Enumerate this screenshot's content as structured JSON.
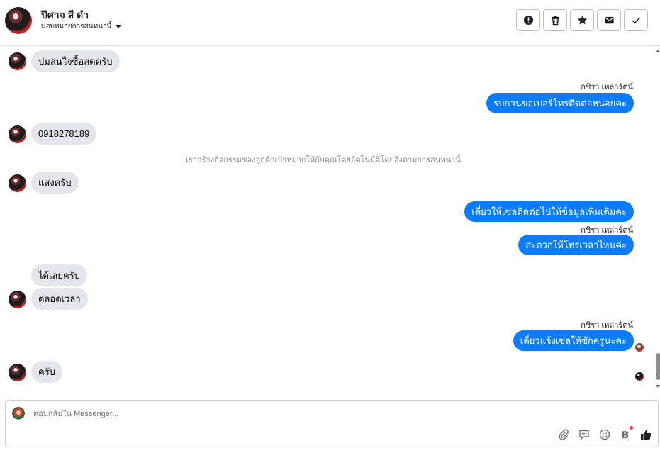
{
  "header": {
    "contact_name": "ปีศาจ สี ดำ",
    "assign_label": "มอบหมายการสนทนานี้",
    "actions": [
      {
        "icon": "alert-icon"
      },
      {
        "icon": "trash-icon"
      },
      {
        "icon": "star-icon"
      },
      {
        "icon": "envelope-icon"
      },
      {
        "icon": "check-icon"
      }
    ]
  },
  "messages": [
    {
      "side": "in",
      "text": "ปมสนใจซื้อสดครับ"
    },
    {
      "side": "out",
      "sender": "กชิรา เหล่ารัตน์",
      "text": "รบกวนขอเบอร์โทรติดต่อหน่อยคะ"
    },
    {
      "side": "in",
      "text": "0918278189"
    },
    {
      "side": "system",
      "text": "เราสร้างกิจกรรมของลูกค้าเป้าหมายให้กับคุณโดยอัตโนมัติโดยอิงตามการสนทนานี้"
    },
    {
      "side": "in",
      "text": "แสงครับ"
    },
    {
      "side": "out",
      "text": "เดี๋ยวให้เซลติดต่อไปให้ข้อมูลเพิ่มเติมคะ"
    },
    {
      "side": "out",
      "sender": "กชิรา เหล่ารัตน์",
      "text": "สะดวกให้โทรเวลาไหนค่ะ"
    },
    {
      "side": "in",
      "text": "ได้เลยครับ"
    },
    {
      "side": "in",
      "text": "ตลอดเวลา"
    },
    {
      "side": "out",
      "sender": "กชิรา เหล่ารัตน์",
      "text": "เดี๋ยวแจ้งเซลให้ซักครู่นะคะ"
    },
    {
      "side": "in",
      "text": "ครับ"
    }
  ],
  "composer": {
    "placeholder": "ตอบกลับใน Messenger...",
    "tools": [
      "paperclip-icon",
      "saved-reply-icon",
      "emoji-icon",
      "baht-icon",
      "like-icon"
    ],
    "baht_symbol": "฿"
  },
  "colors": {
    "outgoing_bubble": "#0a7cff",
    "incoming_bubble": "#e4e6eb",
    "system_text": "#8a8d91"
  }
}
